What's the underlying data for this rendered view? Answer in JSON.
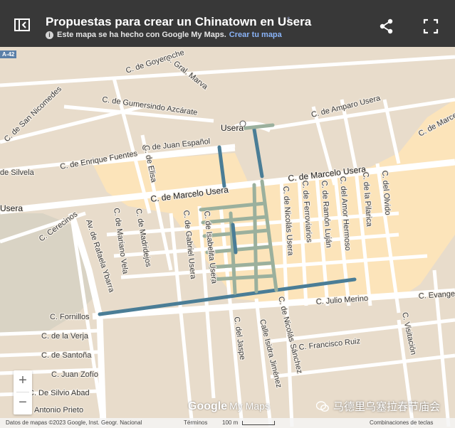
{
  "header": {
    "title": "Propuestas para crear un Chinatown en Usera",
    "star": "*",
    "subtitle_text": "Este mapa se ha hecho con Google My Maps.",
    "create_link": "Crear tu mapa",
    "info_glyph": "i"
  },
  "icons": {
    "back": "panel-toggle-icon",
    "share": "share-icon",
    "fullscreen": "fullscreen-icon",
    "info": "info-icon",
    "wechat": "wechat-icon"
  },
  "road_badge": "A-42",
  "streets": {
    "goyeneche": "C. de Goyeneche",
    "gral_marva": "C. Gral. Marva",
    "gumersindo": "C. de Gumersindo Azcárate",
    "amparo": "C. de Amparo Usera",
    "san_nicomedes": "C. de San Nicomedes",
    "usera_label": "Usera",
    "juan_espanol": "C. de Juan Español",
    "enrique_fuentes": "C. de Enrique Fuentes",
    "silvela": "de Silvela",
    "marcelo_usera_1": "C. de Marcelo Usera",
    "marcelo_usera_2": "C. de Marcelo Usera",
    "usera_left": "Usera",
    "elisa": "C. de Elisa",
    "cerecinos": "C. Cerecinos",
    "rafaela_ybarra": "Av. de Rafaela Ybarra",
    "mariano_vela": "C. de Mariano Vela",
    "madridejos": "C. de Madridejos",
    "gabriel_usera": "C. de Gabriel Usera",
    "isabelita_usera": "C. de Isabelita Usera",
    "nicolas_usera": "C. de Nicolás Usera",
    "ferroviarios": "C. de Ferroviarios",
    "ramon_lujan": "C. de Ramón Luján",
    "amor_hermoso": "C. del Amor Hermoso",
    "pilarica": "C. de la Pilarica",
    "olvido": "C. del Olvido",
    "fornillos": "C. Fornillos",
    "julio_merino": "C. Julio Merino",
    "evangelios": "C. Evange",
    "la_verja": "C. de la Verja",
    "santona": "C. de Santoña",
    "juan_zofio": "C. Juan Zofío",
    "silvio_abad": "C. De Silvio Abad",
    "antonio_prieto": "Antonio Prieto",
    "del_jaspe": "C. del Jaspe",
    "isidra_jimenez": "Calle Isidra Jiménez",
    "nicolas_sanchez": "C. de Nicolás Sánchez",
    "francisco_ruiz": "C. Francisco Ruiz",
    "visitacion": "C. Visitación",
    "marcelo_usera_right": "C. de Marcelo"
  },
  "zoom": {
    "plus": "+",
    "minus": "−"
  },
  "logo": {
    "google": "Google",
    "mymaps": "My Maps"
  },
  "attribution": {
    "data": "Datos de mapas ©2023 Google, Inst. Geogr. Nacional",
    "terms": "Términos",
    "scale": "100 m",
    "shortcuts": "Combinaciones de teclas"
  },
  "watermark": "马德里乌塞拉春节庙会",
  "colors": {
    "header_bg": "#383838",
    "land": "#e8dccb",
    "zone_highlight": "#fde4b8",
    "route_dark": "#4a7d96",
    "route_light": "#9bb09d"
  }
}
